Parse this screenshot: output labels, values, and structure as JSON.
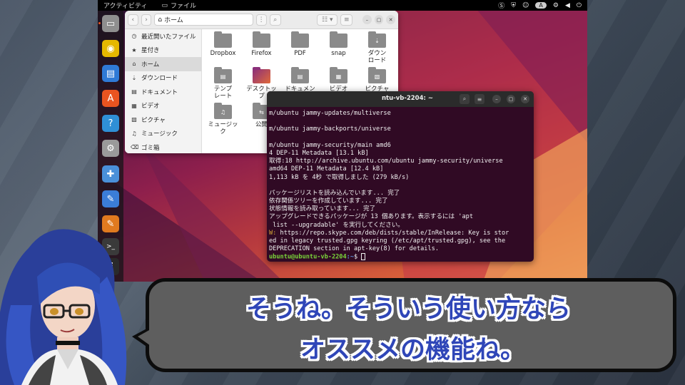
{
  "topbar": {
    "activities": "アクティビティ",
    "app_name": "ファイル",
    "keyboard": "A"
  },
  "dock": {
    "items": [
      {
        "name": "files-icon",
        "glyph": "▭",
        "color": "#8f8f8f"
      },
      {
        "name": "rhythmbox-icon",
        "glyph": "◉",
        "color": "#e6b800"
      },
      {
        "name": "writer-icon",
        "glyph": "▤",
        "color": "#2f7ad6"
      },
      {
        "name": "app-center-icon",
        "glyph": "A",
        "color": "#e95420"
      },
      {
        "name": "help-icon",
        "glyph": "?",
        "color": "#2f8fd6"
      },
      {
        "name": "settings-icon",
        "glyph": "⚙",
        "color": "#9a9a9a"
      },
      {
        "name": "extensions-icon",
        "glyph": "✚",
        "color": "#4a90d9"
      },
      {
        "name": "text-editor-icon",
        "glyph": "✎",
        "color": "#3b7dd8"
      },
      {
        "name": "notes-icon",
        "glyph": "✎",
        "color": "#e07a1f"
      },
      {
        "name": "terminal-icon",
        "glyph": ">_",
        "color": "#3a3a3a"
      },
      {
        "name": "show-apps-icon",
        "glyph": "⠿",
        "color": "#2a2a2a"
      }
    ]
  },
  "file_manager": {
    "location": "ホーム",
    "sidebar": [
      {
        "icon": "◷",
        "label": "最近開いたファイル"
      },
      {
        "icon": "★",
        "label": "星付き"
      },
      {
        "icon": "⌂",
        "label": "ホーム"
      },
      {
        "icon": "⇣",
        "label": "ダウンロード"
      },
      {
        "icon": "▤",
        "label": "ドキュメント"
      },
      {
        "icon": "▦",
        "label": "ビデオ"
      },
      {
        "icon": "▧",
        "label": "ピクチャ"
      },
      {
        "icon": "♫",
        "label": "ミュージック"
      },
      {
        "icon": "⌫",
        "label": "ゴミ箱"
      }
    ],
    "files": [
      {
        "label": "Dropbox",
        "type": "folder"
      },
      {
        "label": "Firefox",
        "type": "folder"
      },
      {
        "label": "PDF",
        "type": "folder"
      },
      {
        "label": "snap",
        "type": "folder"
      },
      {
        "label": "ダウン\nロード",
        "type": "downloads"
      },
      {
        "label": "テンプ\nレート",
        "type": "templates"
      },
      {
        "label": "デスクトッ\nプ",
        "type": "desktop"
      },
      {
        "label": "ドキュメン\nト",
        "type": "documents"
      },
      {
        "label": "ビデオ",
        "type": "videos"
      },
      {
        "label": "ピクチャ",
        "type": "pictures"
      },
      {
        "label": "ミュージッ\nク",
        "type": "music"
      },
      {
        "label": "公開",
        "type": "public"
      }
    ]
  },
  "terminal": {
    "title": "ntu-vb-2204: ~",
    "lines": [
      {
        "text": "m/ubuntu jammy-updates/multiverse",
        "cls": ""
      },
      {
        "text": "",
        "cls": ""
      },
      {
        "text": "m/ubuntu jammy-backports/universe",
        "cls": ""
      },
      {
        "text": "",
        "cls": ""
      },
      {
        "text": "m/ubuntu jammy-security/main amd6",
        "cls": ""
      },
      {
        "text": "4 DEP-11 Metadata [13.1 kB]",
        "cls": ""
      },
      {
        "text": "取得:18 http://archive.ubuntu.com/ubuntu jammy-security/universe",
        "cls": ""
      },
      {
        "text": "amd64 DEP-11 Metadata [12.4 kB]",
        "cls": ""
      },
      {
        "text": "1,113 kB を 4秒 で取得しました (279 kB/s)",
        "cls": ""
      },
      {
        "text": "",
        "cls": ""
      },
      {
        "text": "パッケージリストを読み込んでいます... 完了",
        "cls": ""
      },
      {
        "text": "依存関係ツリーを作成しています... 完了",
        "cls": ""
      },
      {
        "text": "状態情報を読み取っています... 完了",
        "cls": ""
      },
      {
        "text": "アップグレードできるパッケージが 13 個あります。表示するには 'apt",
        "cls": ""
      },
      {
        "text": " list --upgradable' を実行してください。",
        "cls": ""
      }
    ],
    "warn_prefix": "W: ",
    "warn_lines": [
      "https://repo.skype.com/deb/dists/stable/InRelease: Key is stor",
      "ed in legacy trusted.gpg keyring (/etc/apt/trusted.gpg), see the",
      "DEPRECATION section in apt-key(8) for details."
    ],
    "prompt_user": "ubuntu@ubuntu-vb-2204",
    "prompt_path": ":~",
    "prompt_symbol": "$"
  },
  "caption": {
    "line1": "そうね。そういう使い方なら",
    "line2": "オススメの機能ね。"
  }
}
